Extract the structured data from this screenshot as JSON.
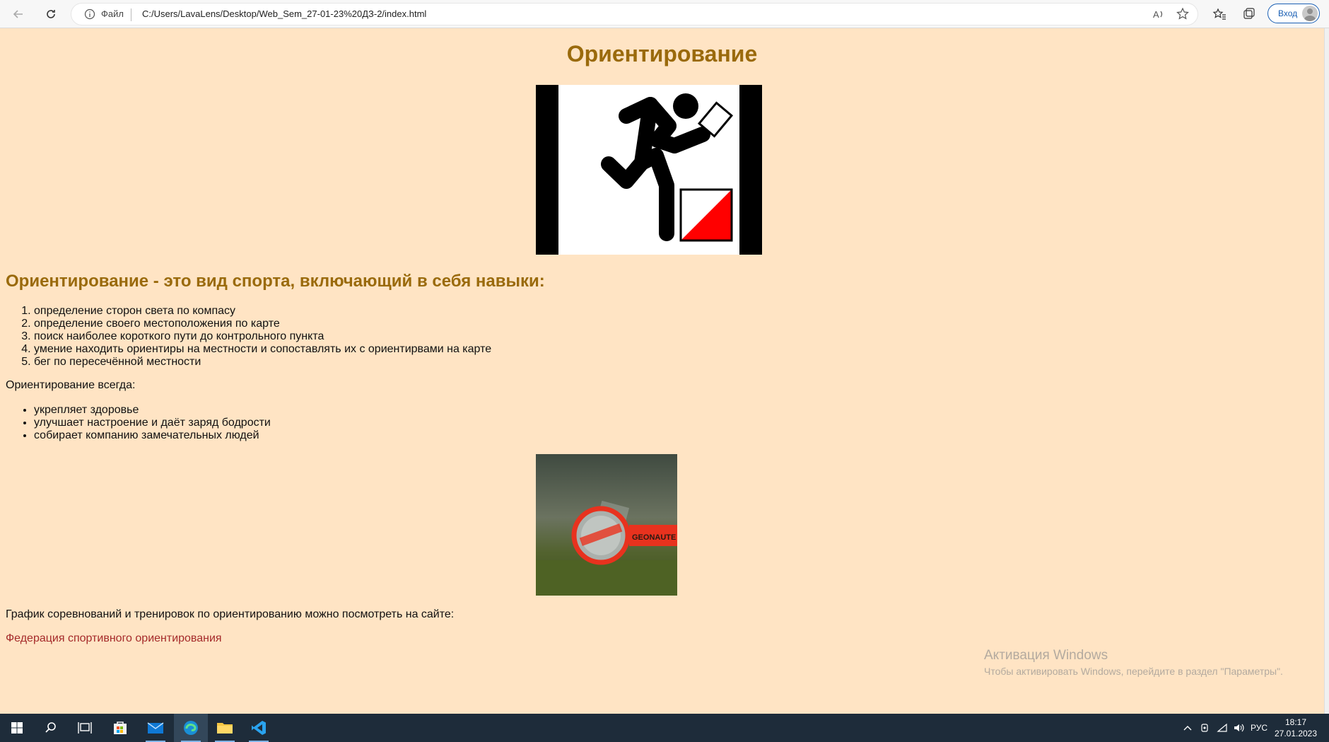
{
  "browser": {
    "file_label": "Файл",
    "url": "C:/Users/LavaLens/Desktop/Web_Sem_27-01-23%20ДЗ-2/index.html",
    "signin_label": "Вход"
  },
  "page": {
    "title": "Ориентирование",
    "subheading": "Ориентирование - это вид спорта, включающий в себя навыки:",
    "skills": [
      "определение сторон света по компасу",
      "определение своего местоположения по карте",
      "поиск наиболее короткого пути до контрольного пункта",
      "умение находить ориентиры на местности и сопоставлять их с ориентирвами на карте",
      "бег по пересечённой местности"
    ],
    "always_text": "Ориентирование всегда:",
    "benefits": [
      "укрепляет здоровье",
      "улучшает настроение и даёт заряд бодрости",
      "собирает компанию замечательных людей"
    ],
    "schedule_text": "График соревнований и тренировок по ориентированию можно посмотреть на сайте:",
    "link_text": "Федерация спортивного ориентирования",
    "photo_caption_text": "GEONAUTE"
  },
  "watermark": {
    "title": "Активация Windows",
    "subtitle": "Чтобы активировать Windows, перейдите в раздел \"Параметры\"."
  },
  "taskbar": {
    "lang": "РУС",
    "time": "18:17",
    "date": "27.01.2023"
  },
  "colors": {
    "page_bg": "#ffe4c4",
    "heading": "#9a6a0c",
    "link": "#a52a2a",
    "control_red": "#ff0000"
  }
}
